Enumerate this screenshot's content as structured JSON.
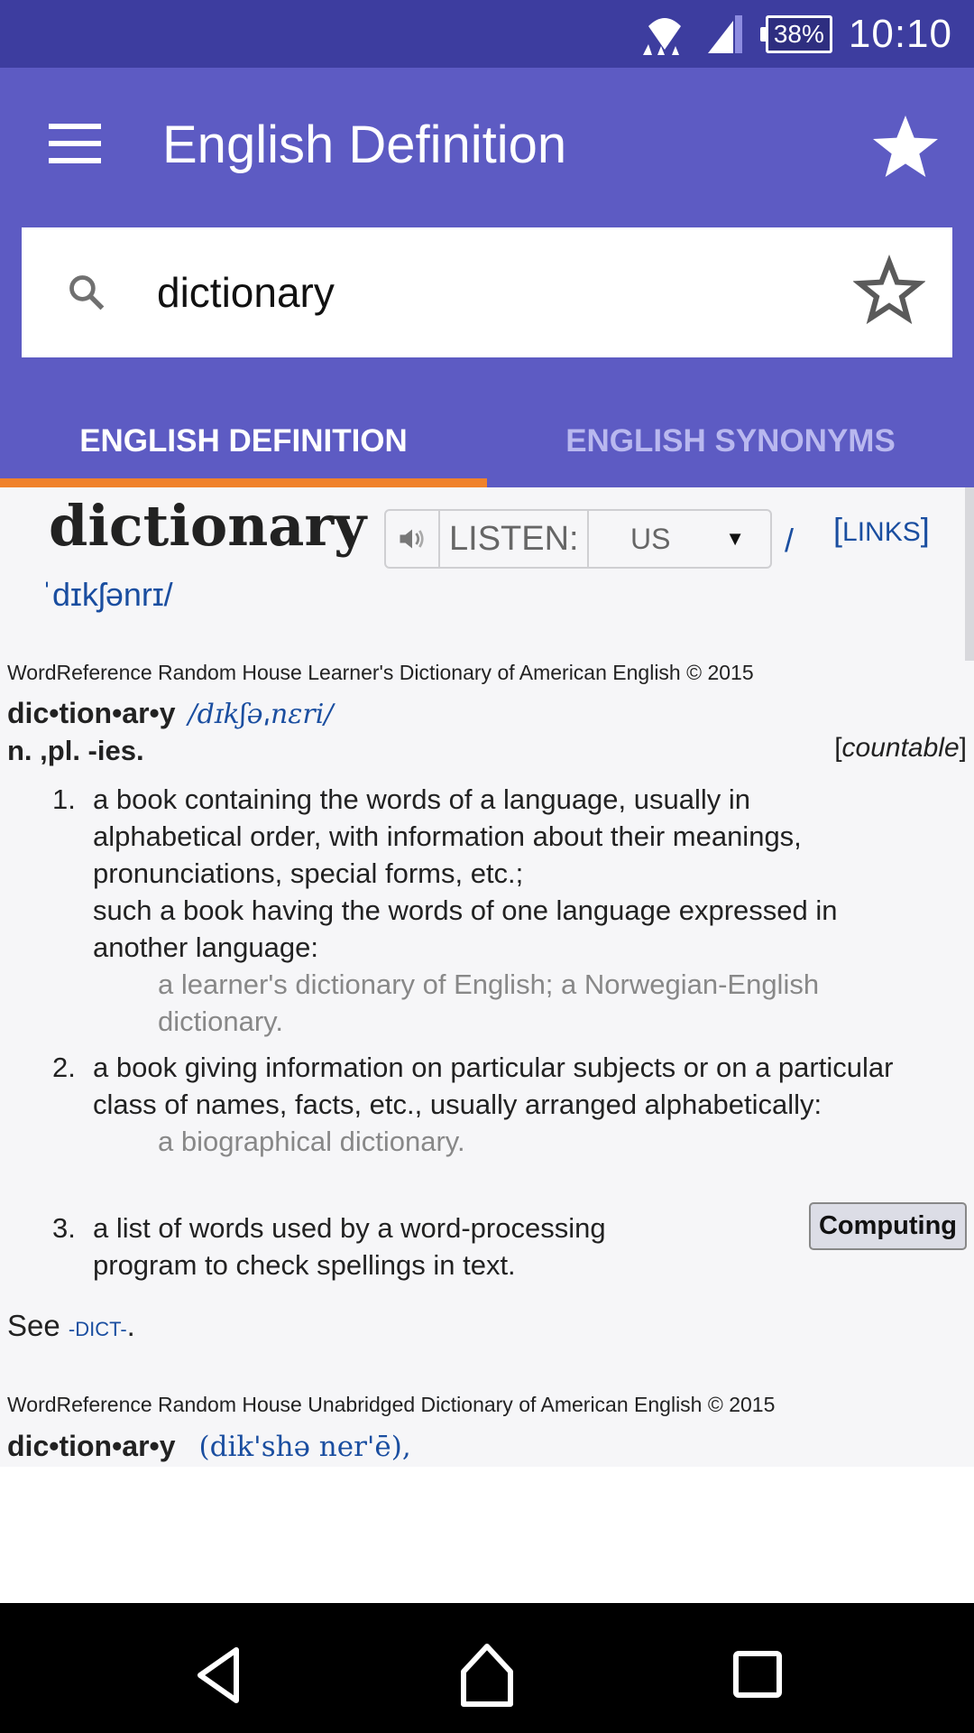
{
  "status_bar": {
    "battery": "38%",
    "time": "10:10"
  },
  "app_bar": {
    "title": "English Definition",
    "menu_icon": "hamburger-menu-icon",
    "favorite_icon": "star-filled-icon"
  },
  "search": {
    "value": "dictionary",
    "search_icon": "search-icon",
    "bookmark_icon": "star-outline-icon"
  },
  "tabs": [
    {
      "label": "ENGLISH DEFINITION",
      "active": true
    },
    {
      "label": "ENGLISH SYNONYMS",
      "active": false
    }
  ],
  "colors": {
    "status_bar": "#3d3d9f",
    "primary": "#5d5bc3",
    "tab_indicator": "#f0822a",
    "link": "#1a4ea0"
  },
  "entry": {
    "headword": "dictionary",
    "listen_label": "LISTEN:",
    "accent_selected": "US",
    "slash": "/",
    "links_open": "[",
    "links_label": "LINKS",
    "links_close": "]",
    "ipa": "ˈdɪkʃənrɪ/",
    "source1": "WordReference Random House Learner's Dictionary of American English © 2015",
    "syllabified": "dic•tion•ar•y",
    "pron1": "/dɪkʃəˌnɛri/",
    "pos": "n. ,pl. -ies.",
    "countable_open": "[",
    "countable": "countable",
    "countable_close": "]",
    "senses": [
      {
        "num": "1.",
        "lines": [
          "a book containing the words of a language, usually in alphabetical order, with information about their meanings, pronunciations, special forms, etc.;",
          "such a book having the words of one language expressed in another language:"
        ],
        "example": "a learner's dictionary of English; a Norwegian-English dictionary."
      },
      {
        "num": "2.",
        "lines": [
          "a book giving information on particular subjects or on a particular class of names, facts, etc., usually arranged alphabetically:"
        ],
        "example": "a biographical dictionary."
      },
      {
        "num": "3.",
        "lines": [
          "a list of words used by a word-processing program to check spellings in text."
        ],
        "tag": "Computing"
      }
    ],
    "see_label": "See",
    "see_ref": "-DICT-",
    "see_end": ".",
    "source2": "WordReference Random House Unabridged Dictionary of American English © 2015",
    "syllabified2": "dic•tion•ar•y",
    "pron2": "(dik'shə ner'ē),"
  },
  "nav_bar": {
    "back_icon": "back-icon",
    "home_icon": "home-icon",
    "recents_icon": "recents-icon"
  }
}
